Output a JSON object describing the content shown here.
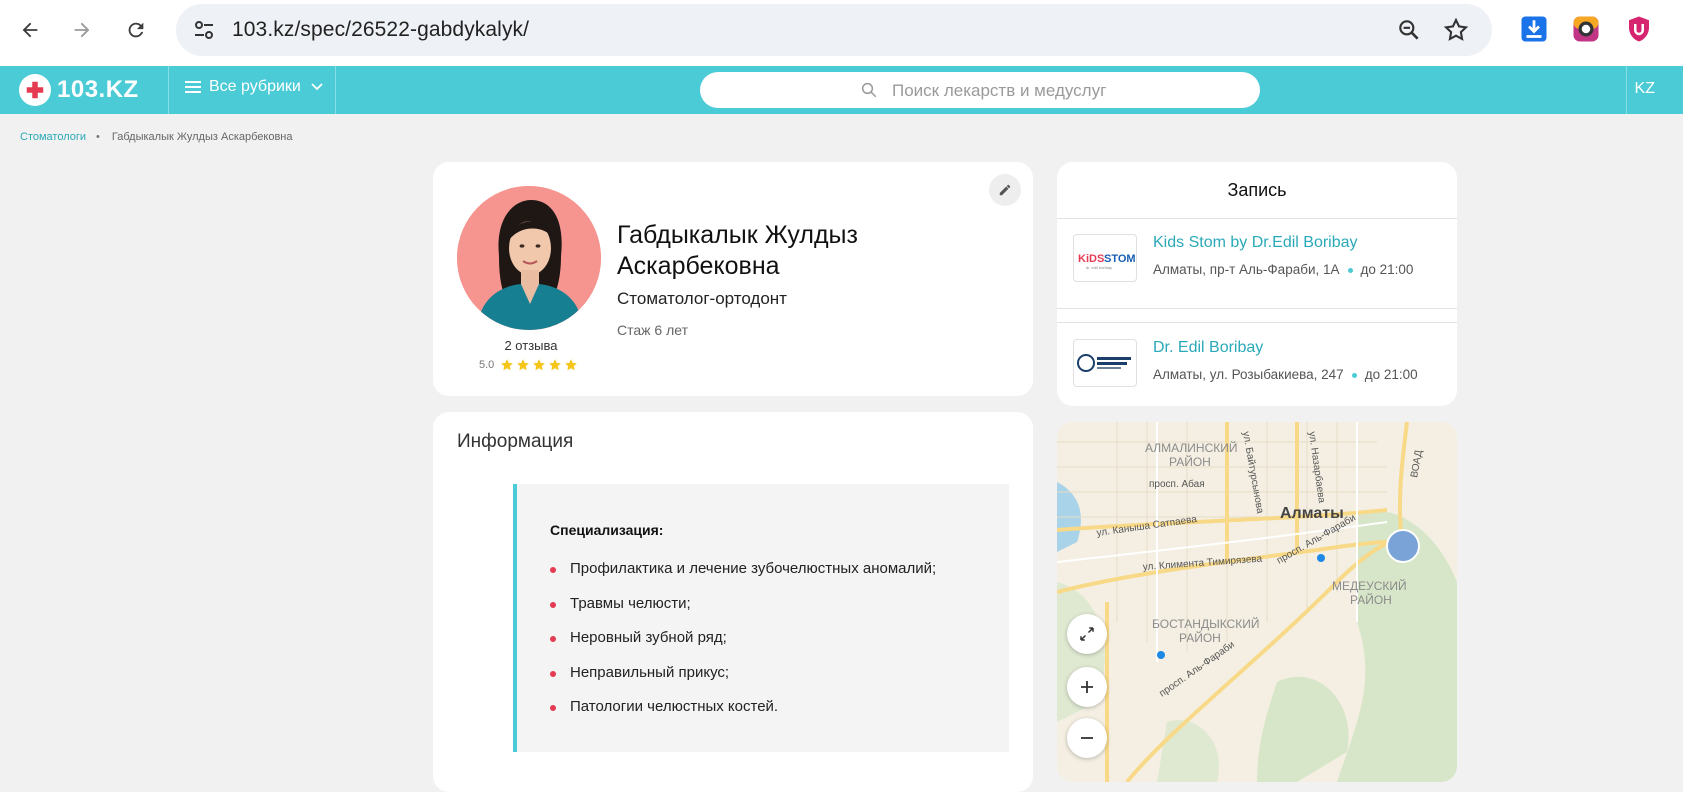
{
  "browser": {
    "url": "103.kz/spec/26522-gabdykalyk/"
  },
  "header": {
    "logo_text": "103.KZ",
    "rubrics_label": "Все рубрики",
    "search_placeholder": "Поиск лекарств и медуслуг",
    "lang": "KZ"
  },
  "breadcrumb": {
    "parent": "Стоматологи",
    "current": "Габдыкалык Жулдыз Аскарбековна"
  },
  "profile": {
    "name": "Габдыкалык Жулдыз Аскарбековна",
    "specialty": "Стоматолог-ортодонт",
    "experience": "Стаж 6 лет",
    "reviews": "2 отзыва",
    "rating": "5.0",
    "stars": 5
  },
  "info": {
    "title": "Информация",
    "spec_heading": "Специализация:",
    "items": [
      "Профилактика и лечение зубочелюстных аномалий;",
      "Травмы челюсти;",
      "Неровный зубной ряд;",
      "Неправильный прикус;",
      "Патологии челюстных костей."
    ]
  },
  "booking": {
    "title": "Запись",
    "clinics": [
      {
        "name": "Kids Stom by Dr.Edil Boribay",
        "address": "Алматы, пр-т Аль-Фараби, 1А",
        "hours": "до 21:00"
      },
      {
        "name": "Dr. Edil Boribay",
        "address": "Алматы, ул. Розыбакиева, 247",
        "hours": "до 21:00"
      }
    ]
  },
  "map": {
    "city": "Алматы",
    "labels": [
      "АЛМАЛИНСКИЙ",
      "РАЙОН",
      "МЕДЕУСКИЙ",
      "РАЙОН",
      "БОСТАНДЫКСКИЙ",
      "РАЙОН",
      "просп. Абая",
      "ул. Каныша Сатпаева",
      "ул. Климента Тимирязева",
      "просп. Аль-Фараби",
      "просп. Аль-Фараби",
      "ул. Байтурсынова",
      "ул. Назарбаева",
      "ВОАД"
    ]
  },
  "colors": {
    "brand": "#4bcbd6",
    "link": "#2aa9b8",
    "bullet": "#e53b52",
    "star": "#f5c518"
  }
}
